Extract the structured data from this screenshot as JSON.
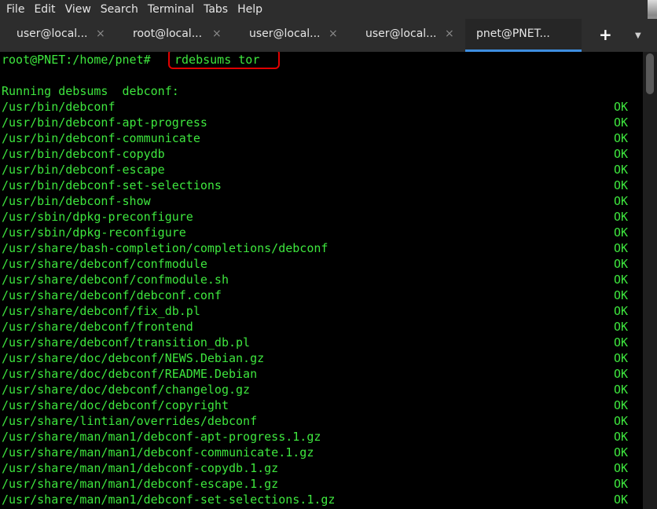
{
  "menu": [
    "File",
    "Edit",
    "View",
    "Search",
    "Terminal",
    "Tabs",
    "Help"
  ],
  "tabs": [
    {
      "label": "user@local...",
      "close": "×"
    },
    {
      "label": "root@local...",
      "close": "×"
    },
    {
      "label": "user@local...",
      "close": "×"
    },
    {
      "label": "user@local...",
      "close": "×"
    },
    {
      "label": "pnet@PNET...",
      "close": "×"
    }
  ],
  "new_tab_label": "+",
  "tab_menu_label": "▼",
  "terminal": {
    "prompt": "root@PNET:/home/pnet#",
    "command": "rdebsums tor",
    "heading": "Running debsums  debconf:",
    "status": "OK",
    "files": [
      "/usr/bin/debconf",
      "/usr/bin/debconf-apt-progress",
      "/usr/bin/debconf-communicate",
      "/usr/bin/debconf-copydb",
      "/usr/bin/debconf-escape",
      "/usr/bin/debconf-set-selections",
      "/usr/bin/debconf-show",
      "/usr/sbin/dpkg-preconfigure",
      "/usr/sbin/dpkg-reconfigure",
      "/usr/share/bash-completion/completions/debconf",
      "/usr/share/debconf/confmodule",
      "/usr/share/debconf/confmodule.sh",
      "/usr/share/debconf/debconf.conf",
      "/usr/share/debconf/fix_db.pl",
      "/usr/share/debconf/frontend",
      "/usr/share/debconf/transition_db.pl",
      "/usr/share/doc/debconf/NEWS.Debian.gz",
      "/usr/share/doc/debconf/README.Debian",
      "/usr/share/doc/debconf/changelog.gz",
      "/usr/share/doc/debconf/copyright",
      "/usr/share/lintian/overrides/debconf",
      "/usr/share/man/man1/debconf-apt-progress.1.gz",
      "/usr/share/man/man1/debconf-communicate.1.gz",
      "/usr/share/man/man1/debconf-copydb.1.gz",
      "/usr/share/man/man1/debconf-escape.1.gz",
      "/usr/share/man/man1/debconf-set-selections.1.gz"
    ]
  },
  "colors": {
    "terminal_text": "#3ee63e",
    "highlight_box": "#e00000",
    "active_tab_indicator": "#3e8ee0"
  }
}
